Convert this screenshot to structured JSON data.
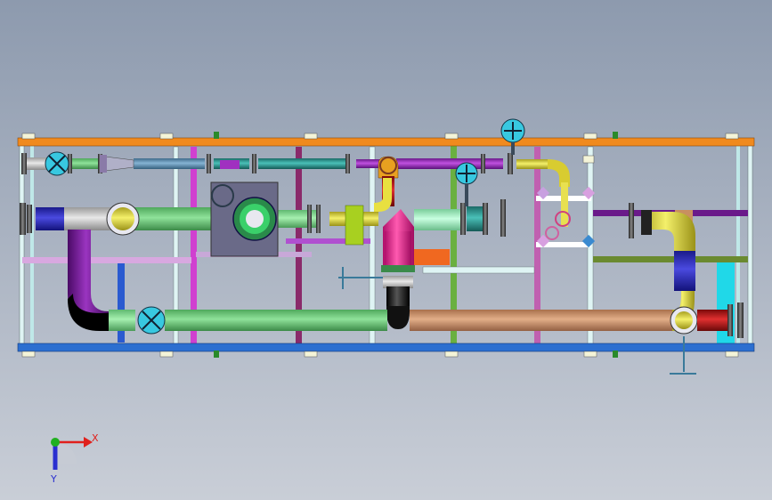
{
  "view": {
    "background_top": "#8d9aae",
    "background_bottom": "#c9ced7"
  },
  "triad": {
    "x_label": "X",
    "y_label": "Y",
    "x_color": "#e0201c",
    "y_color": "#2a2fd0",
    "z_color": "#20b020"
  },
  "model": {
    "frame_top_color": "#f08a1e",
    "frame_bottom_color": "#2c6fd0",
    "frame_side_color": "#dff4f4",
    "accent_colors": {
      "main_pipe_green": "#6cd07a",
      "lower_pipe_tan": "#c9906a",
      "elbow_yellow": "#e8e03a",
      "elbow_purple": "#7a1a9a",
      "riser_magenta": "#f0208a",
      "pipe_black": "#151515",
      "valve_cyan": "#38c8e0"
    }
  }
}
